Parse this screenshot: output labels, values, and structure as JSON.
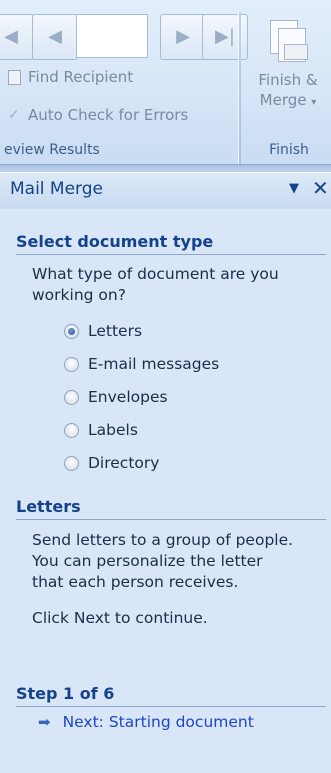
{
  "ribbon": {
    "preview_group": {
      "find_recipient": "Find Recipient",
      "auto_check": "Auto Check for Errors",
      "group_label": "eview Results"
    },
    "finish_group": {
      "button_line1": "Finish &",
      "button_line2": "Merge",
      "group_label": "Finish"
    }
  },
  "pane": {
    "title": "Mail Merge",
    "section1": {
      "heading": "Select document type",
      "prompt_line1": "What type of document are you",
      "prompt_line2": "working on?"
    },
    "options": [
      {
        "label": "Letters",
        "checked": true
      },
      {
        "label": "E-mail messages",
        "checked": false
      },
      {
        "label": "Envelopes",
        "checked": false
      },
      {
        "label": "Labels",
        "checked": false
      },
      {
        "label": "Directory",
        "checked": false
      }
    ],
    "section2": {
      "heading": "Letters",
      "desc_line1": "Send letters to a group of people.",
      "desc_line2": "You can personalize the letter",
      "desc_line3": "that each person receives.",
      "instruction": "Click Next to continue."
    },
    "step": {
      "heading": "Step 1 of 6",
      "next_label": "Next: Starting document"
    }
  }
}
